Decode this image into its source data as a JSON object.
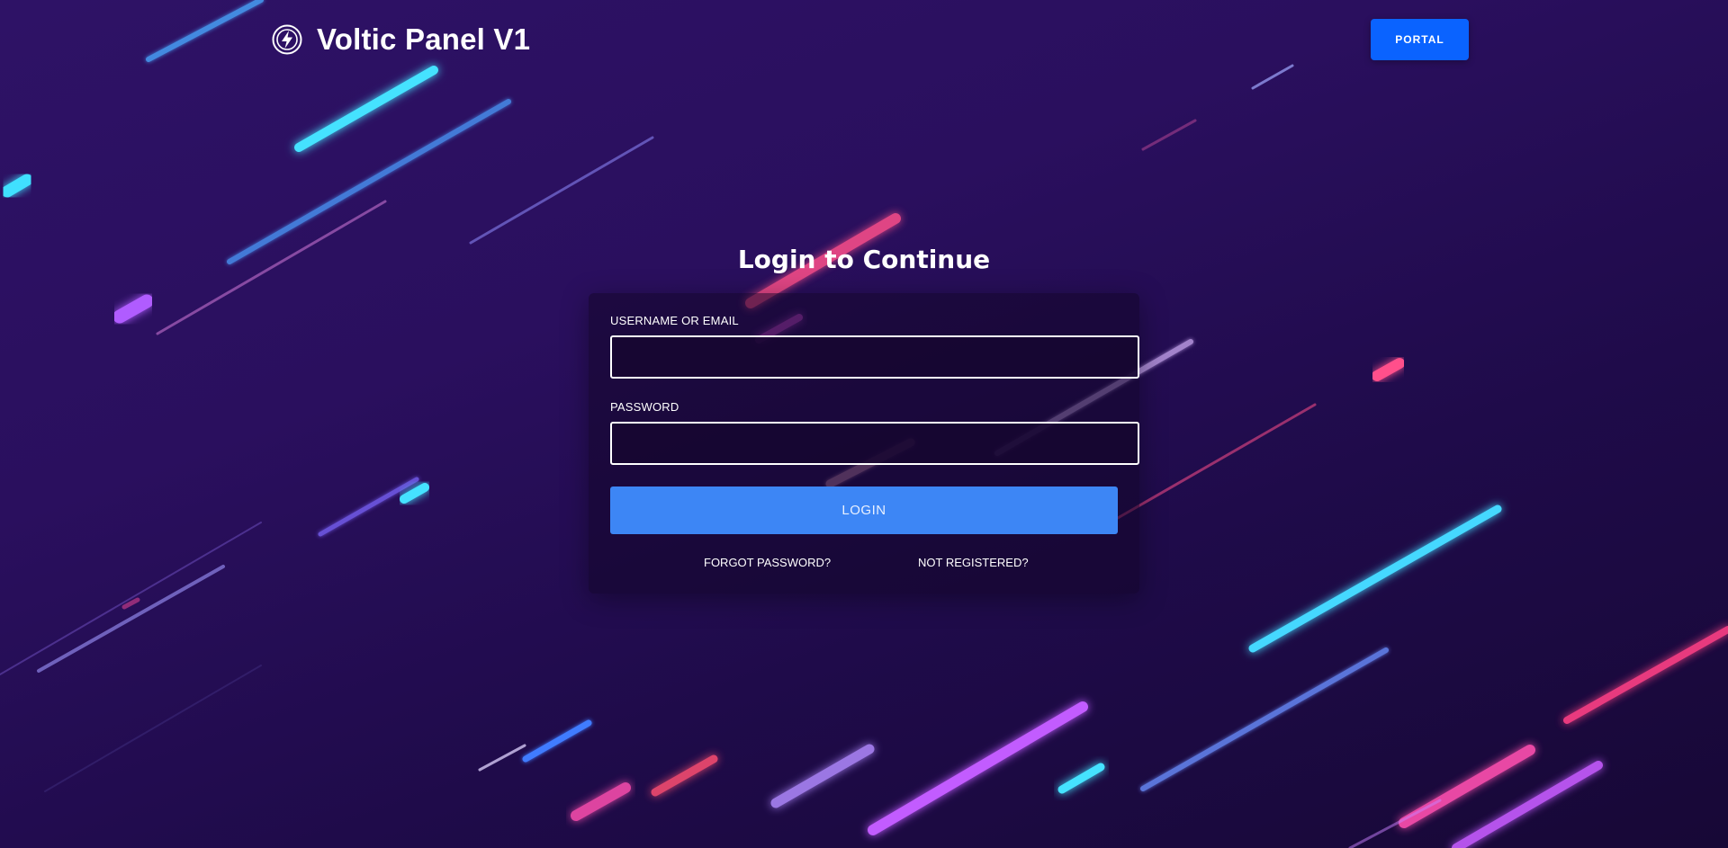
{
  "header": {
    "brand_title": "Voltic Panel V1",
    "logo_icon": "lightning-bolt-badge-icon",
    "portal_label": "PORTAL"
  },
  "login": {
    "title": "Login to Continue",
    "username_label": "USERNAME OR EMAIL",
    "username_value": "",
    "password_label": "PASSWORD",
    "password_value": "",
    "login_label": "LOGIN",
    "forgot_label": "FORGOT PASSWORD?",
    "register_label": "NOT REGISTERED?"
  },
  "colors": {
    "background": "#2a0f5e",
    "portal_button": "#0a63ff",
    "login_button": "#3d86f5",
    "neon_cyan": "#3fe0ff",
    "neon_pink": "#ff4f8b",
    "neon_purple": "#c65bff"
  }
}
